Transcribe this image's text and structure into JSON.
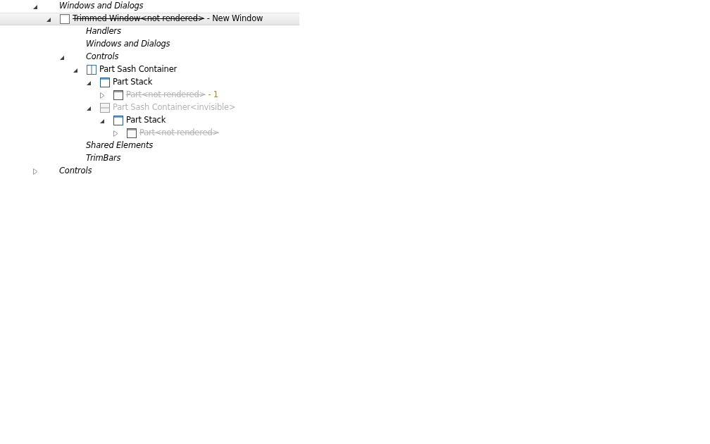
{
  "tree": [
    {
      "label": "Windows and Dialogs",
      "kind": "folder",
      "expanded": true,
      "selected": false,
      "struck": false,
      "dimmed": false,
      "children": [
        {
          "label": "Trimmed Window<not rendered>",
          "suffix": " - New Window",
          "color": "#000000",
          "kind": "window",
          "expanded": true,
          "selected": true,
          "struck": true,
          "dimmed": false,
          "children": [
            {
              "label": "Handlers",
              "kind": "folder",
              "selected": false,
              "struck": false,
              "dimmed": false
            },
            {
              "label": "Windows and Dialogs",
              "kind": "folder",
              "selected": false,
              "struck": false,
              "dimmed": false
            },
            {
              "label": "Controls",
              "kind": "folder",
              "expanded": true,
              "selected": false,
              "struck": false,
              "dimmed": false,
              "children": [
                {
                  "label": "Part Sash Container",
                  "kind": "sash-vertical",
                  "expanded": true,
                  "selected": false,
                  "struck": false,
                  "dimmed": false,
                  "children": [
                    {
                      "label": "Part Stack",
                      "kind": "stack",
                      "expanded": true,
                      "selected": false,
                      "struck": false,
                      "dimmed": false,
                      "children": [
                        {
                          "label": "Part<not rendered>",
                          "suffix": " - 1",
                          "color": "#9a8a3a",
                          "kind": "part",
                          "expanded": false,
                          "selected": false,
                          "struck": true,
                          "dimmed": true
                        }
                      ]
                    },
                    {
                      "label": "Part Sash Container<invisible>",
                      "kind": "sash-horizontal",
                      "expanded": true,
                      "selected": false,
                      "struck": false,
                      "dimmed": true,
                      "children": [
                        {
                          "label": "Part Stack",
                          "kind": "stack",
                          "expanded": true,
                          "selected": false,
                          "struck": false,
                          "dimmed": false,
                          "children": [
                            {
                              "label": "Part<not rendered>",
                              "kind": "part",
                              "expanded": false,
                              "selected": false,
                              "struck": true,
                              "dimmed": true
                            }
                          ]
                        }
                      ]
                    }
                  ]
                }
              ]
            },
            {
              "label": "Shared Elements",
              "kind": "folder",
              "selected": false,
              "struck": false,
              "dimmed": false
            },
            {
              "label": "TrimBars",
              "kind": "folder",
              "selected": false,
              "struck": false,
              "dimmed": false
            }
          ]
        }
      ]
    },
    {
      "label": "Controls",
      "kind": "folder",
      "expanded": false,
      "selected": false,
      "struck": false,
      "dimmed": false
    }
  ]
}
